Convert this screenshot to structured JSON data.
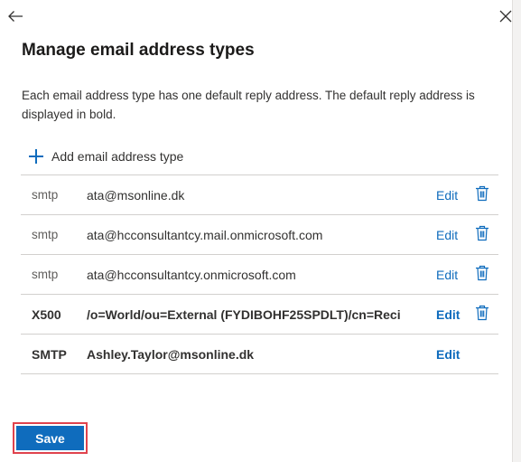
{
  "header": {
    "title": "Manage email address types",
    "description": "Each email address type has one default reply address. The default reply address is displayed in bold.",
    "back_icon": "arrow-left-icon",
    "close_icon": "close-icon"
  },
  "add_button": {
    "label": "Add email address type",
    "icon": "plus-icon"
  },
  "rows": [
    {
      "type": "smtp",
      "address": "ata@msonline.dk",
      "edit_label": "Edit",
      "is_default": false,
      "deletable": true
    },
    {
      "type": "smtp",
      "address": "ata@hcconsultantcy.mail.onmicrosoft.com",
      "edit_label": "Edit",
      "is_default": false,
      "deletable": true
    },
    {
      "type": "smtp",
      "address": "ata@hcconsultantcy.onmicrosoft.com",
      "edit_label": "Edit",
      "is_default": false,
      "deletable": true
    },
    {
      "type": "X500",
      "address": "/o=World/ou=External (FYDIBOHF25SPDLT)/cn=Reci",
      "edit_label": "Edit",
      "is_default": true,
      "deletable": true
    },
    {
      "type": "SMTP",
      "address": "Ashley.Taylor@msonline.dk",
      "edit_label": "Edit",
      "is_default": true,
      "deletable": false
    }
  ],
  "footer": {
    "save_label": "Save"
  },
  "colors": {
    "accent": "#0f6cbd",
    "highlight_outline": "#e0434d",
    "divider": "#d2d0ce",
    "text": "#323130"
  }
}
